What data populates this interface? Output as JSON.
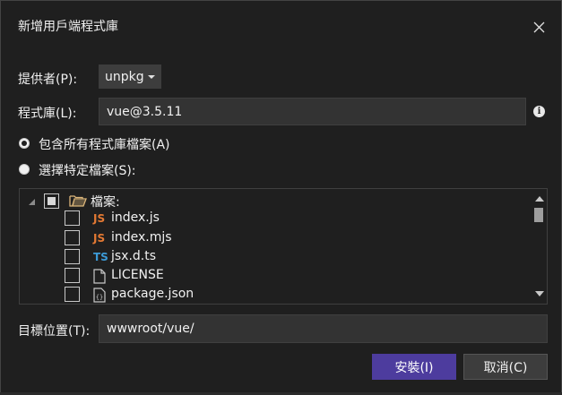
{
  "dialog": {
    "title": "新增用戶端程式庫",
    "close_icon": "close-icon"
  },
  "provider": {
    "label": "提供者(P):",
    "value": "unpkg"
  },
  "library": {
    "label": "程式庫(L):",
    "value": "vue@3.5.11",
    "info_icon": "info-icon"
  },
  "options": {
    "include_all": "包含所有程式庫檔案(A)",
    "choose_specific": "選擇特定檔案(S):",
    "selected": "include_all"
  },
  "tree": {
    "root_label": "檔案:",
    "files": [
      {
        "icon": "JS",
        "name": "index.js",
        "icon_color": "#e37933"
      },
      {
        "icon": "JS",
        "name": "index.mjs",
        "icon_color": "#e37933"
      },
      {
        "icon": "TS",
        "name": "jsx.d.ts",
        "icon_color": "#3c9ad6"
      },
      {
        "icon": "file-icon",
        "name": "LICENSE",
        "icon_color": "#c8c8c8"
      },
      {
        "icon": "json-file-icon",
        "name": "package.json",
        "icon_color": "#c8c8c8"
      }
    ]
  },
  "target": {
    "label": "目標位置(T):",
    "value": "wwwroot/vue/"
  },
  "buttons": {
    "install": "安裝(I)",
    "cancel": "取消(C)"
  },
  "colors": {
    "background": "#1f1f1f",
    "accent": "#4d3c9e",
    "input_bg": "#333333"
  }
}
